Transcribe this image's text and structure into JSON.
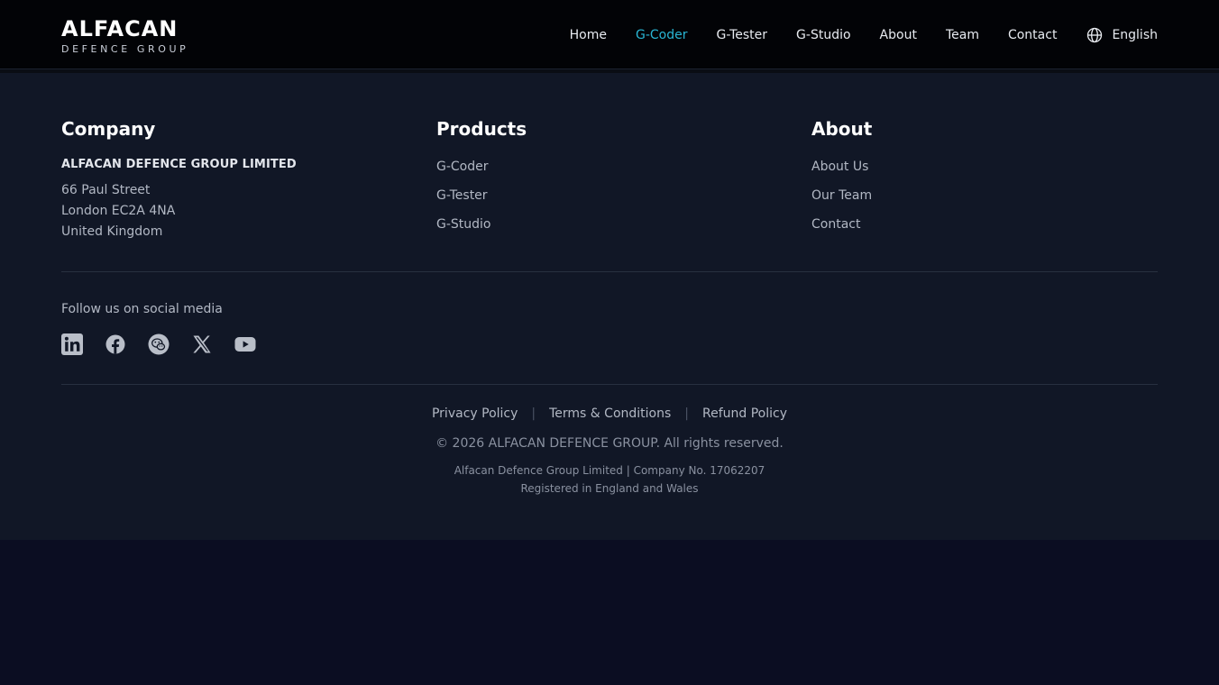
{
  "brand": {
    "title": "ALFACAN",
    "subtitle": "DEFENCE GROUP"
  },
  "nav": {
    "items": [
      {
        "label": "Home",
        "active": false
      },
      {
        "label": "G-Coder",
        "active": true
      },
      {
        "label": "G-Tester",
        "active": false
      },
      {
        "label": "G-Studio",
        "active": false
      },
      {
        "label": "About",
        "active": false
      },
      {
        "label": "Team",
        "active": false
      },
      {
        "label": "Contact",
        "active": false
      }
    ],
    "language": {
      "label": "English",
      "icon": "globe-icon"
    },
    "active_color": "#29b6d4"
  },
  "footer": {
    "company": {
      "title": "Company",
      "name": "ALFACAN DEFENCE GROUP LIMITED",
      "address": [
        "66 Paul Street",
        "London EC2A 4NA",
        "United Kingdom"
      ]
    },
    "products": {
      "title": "Products",
      "links": [
        "G-Coder",
        "G-Tester",
        "G-Studio"
      ]
    },
    "about": {
      "title": "About",
      "links": [
        "About Us",
        "Our Team",
        "Contact"
      ]
    },
    "social": {
      "label": "Follow us on social media",
      "icons": [
        "linkedin-icon",
        "facebook-icon",
        "wechat-icon",
        "x-icon",
        "youtube-icon"
      ]
    },
    "legal": {
      "links": [
        "Privacy Policy",
        "Terms & Conditions",
        "Refund Policy"
      ],
      "separator": "|"
    },
    "copyright": "© 2026 ALFACAN DEFENCE GROUP. All rights reserved.",
    "registration": [
      "Alfacan Defence Group Limited | Company No. 17062207",
      "Registered in England and Wales"
    ]
  }
}
